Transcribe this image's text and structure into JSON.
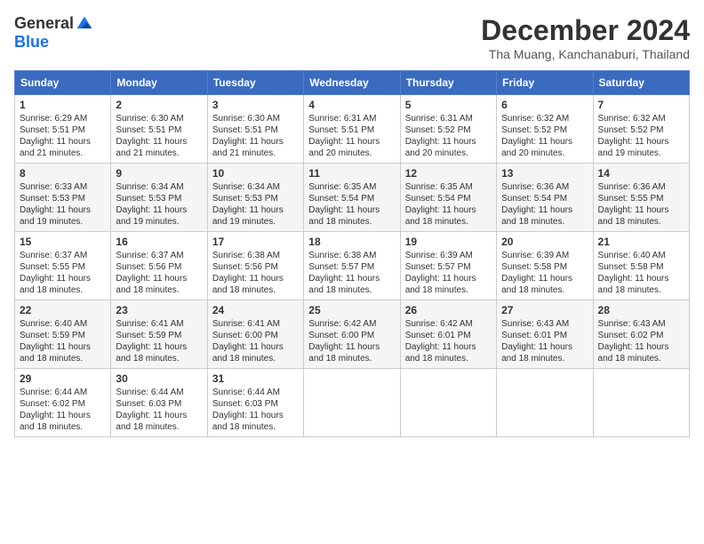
{
  "logo": {
    "general": "General",
    "blue": "Blue"
  },
  "header": {
    "month": "December 2024",
    "location": "Tha Muang, Kanchanaburi, Thailand"
  },
  "weekdays": [
    "Sunday",
    "Monday",
    "Tuesday",
    "Wednesday",
    "Thursday",
    "Friday",
    "Saturday"
  ],
  "weeks": [
    [
      {
        "day": "1",
        "sunrise": "6:29 AM",
        "sunset": "5:51 PM",
        "daylight": "11 hours and 21 minutes."
      },
      {
        "day": "2",
        "sunrise": "6:30 AM",
        "sunset": "5:51 PM",
        "daylight": "11 hours and 21 minutes."
      },
      {
        "day": "3",
        "sunrise": "6:30 AM",
        "sunset": "5:51 PM",
        "daylight": "11 hours and 21 minutes."
      },
      {
        "day": "4",
        "sunrise": "6:31 AM",
        "sunset": "5:51 PM",
        "daylight": "11 hours and 20 minutes."
      },
      {
        "day": "5",
        "sunrise": "6:31 AM",
        "sunset": "5:52 PM",
        "daylight": "11 hours and 20 minutes."
      },
      {
        "day": "6",
        "sunrise": "6:32 AM",
        "sunset": "5:52 PM",
        "daylight": "11 hours and 20 minutes."
      },
      {
        "day": "7",
        "sunrise": "6:32 AM",
        "sunset": "5:52 PM",
        "daylight": "11 hours and 19 minutes."
      }
    ],
    [
      {
        "day": "8",
        "sunrise": "6:33 AM",
        "sunset": "5:53 PM",
        "daylight": "11 hours and 19 minutes."
      },
      {
        "day": "9",
        "sunrise": "6:34 AM",
        "sunset": "5:53 PM",
        "daylight": "11 hours and 19 minutes."
      },
      {
        "day": "10",
        "sunrise": "6:34 AM",
        "sunset": "5:53 PM",
        "daylight": "11 hours and 19 minutes."
      },
      {
        "day": "11",
        "sunrise": "6:35 AM",
        "sunset": "5:54 PM",
        "daylight": "11 hours and 18 minutes."
      },
      {
        "day": "12",
        "sunrise": "6:35 AM",
        "sunset": "5:54 PM",
        "daylight": "11 hours and 18 minutes."
      },
      {
        "day": "13",
        "sunrise": "6:36 AM",
        "sunset": "5:54 PM",
        "daylight": "11 hours and 18 minutes."
      },
      {
        "day": "14",
        "sunrise": "6:36 AM",
        "sunset": "5:55 PM",
        "daylight": "11 hours and 18 minutes."
      }
    ],
    [
      {
        "day": "15",
        "sunrise": "6:37 AM",
        "sunset": "5:55 PM",
        "daylight": "11 hours and 18 minutes."
      },
      {
        "day": "16",
        "sunrise": "6:37 AM",
        "sunset": "5:56 PM",
        "daylight": "11 hours and 18 minutes."
      },
      {
        "day": "17",
        "sunrise": "6:38 AM",
        "sunset": "5:56 PM",
        "daylight": "11 hours and 18 minutes."
      },
      {
        "day": "18",
        "sunrise": "6:38 AM",
        "sunset": "5:57 PM",
        "daylight": "11 hours and 18 minutes."
      },
      {
        "day": "19",
        "sunrise": "6:39 AM",
        "sunset": "5:57 PM",
        "daylight": "11 hours and 18 minutes."
      },
      {
        "day": "20",
        "sunrise": "6:39 AM",
        "sunset": "5:58 PM",
        "daylight": "11 hours and 18 minutes."
      },
      {
        "day": "21",
        "sunrise": "6:40 AM",
        "sunset": "5:58 PM",
        "daylight": "11 hours and 18 minutes."
      }
    ],
    [
      {
        "day": "22",
        "sunrise": "6:40 AM",
        "sunset": "5:59 PM",
        "daylight": "11 hours and 18 minutes."
      },
      {
        "day": "23",
        "sunrise": "6:41 AM",
        "sunset": "5:59 PM",
        "daylight": "11 hours and 18 minutes."
      },
      {
        "day": "24",
        "sunrise": "6:41 AM",
        "sunset": "6:00 PM",
        "daylight": "11 hours and 18 minutes."
      },
      {
        "day": "25",
        "sunrise": "6:42 AM",
        "sunset": "6:00 PM",
        "daylight": "11 hours and 18 minutes."
      },
      {
        "day": "26",
        "sunrise": "6:42 AM",
        "sunset": "6:01 PM",
        "daylight": "11 hours and 18 minutes."
      },
      {
        "day": "27",
        "sunrise": "6:43 AM",
        "sunset": "6:01 PM",
        "daylight": "11 hours and 18 minutes."
      },
      {
        "day": "28",
        "sunrise": "6:43 AM",
        "sunset": "6:02 PM",
        "daylight": "11 hours and 18 minutes."
      }
    ],
    [
      {
        "day": "29",
        "sunrise": "6:44 AM",
        "sunset": "6:02 PM",
        "daylight": "11 hours and 18 minutes."
      },
      {
        "day": "30",
        "sunrise": "6:44 AM",
        "sunset": "6:03 PM",
        "daylight": "11 hours and 18 minutes."
      },
      {
        "day": "31",
        "sunrise": "6:44 AM",
        "sunset": "6:03 PM",
        "daylight": "11 hours and 18 minutes."
      },
      null,
      null,
      null,
      null
    ]
  ]
}
